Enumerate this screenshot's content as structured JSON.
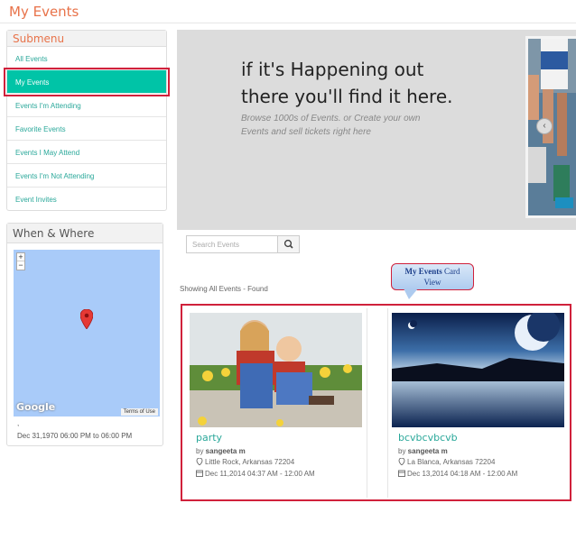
{
  "page": {
    "title": "My Events"
  },
  "submenu": {
    "title": "Submenu",
    "items": [
      {
        "label": "All Events"
      },
      {
        "label": "My Events"
      },
      {
        "label": "Events I'm Attending"
      },
      {
        "label": "Favorite Events"
      },
      {
        "label": "Events I May Attend"
      },
      {
        "label": "Events I'm Not Attending"
      },
      {
        "label": "Event Invites"
      }
    ],
    "active_index": 1
  },
  "when_where": {
    "title": "When & Where",
    "map": {
      "zoom_in": "+",
      "zoom_out": "−",
      "brand": "Google",
      "terms": "Terms of Use"
    },
    "location": ",",
    "date_range": "Dec 31,1970 06:00 PM to 06:00 PM"
  },
  "hero": {
    "headline": "if it's Happening out there you'll find it here.",
    "subtext": "Browse 1000s of Events. or Create your own Events and sell tickets right here"
  },
  "search": {
    "placeholder": "Search Events"
  },
  "listing": {
    "status": "Showing All Events - Found"
  },
  "callout": {
    "bold": "My Events",
    "text": " Card",
    "line2": "View"
  },
  "events": [
    {
      "title": "party",
      "by_prefix": "by ",
      "author": "sangeeta m",
      "location": "Little Rock, Arkansas 72204",
      "date": "Dec 11,2014 04:37 AM - 12:00 AM"
    },
    {
      "title": "bcvbcvbcvb",
      "by_prefix": "by ",
      "author": "sangeeta m",
      "location": "La Blanca, Arkansas 72204",
      "date": "Dec 13,2014 04:18 AM - 12:00 AM"
    }
  ],
  "colors": {
    "accent_teal": "#00c4a7",
    "title_orange": "#e8734a",
    "highlight_red": "#d0213b"
  }
}
